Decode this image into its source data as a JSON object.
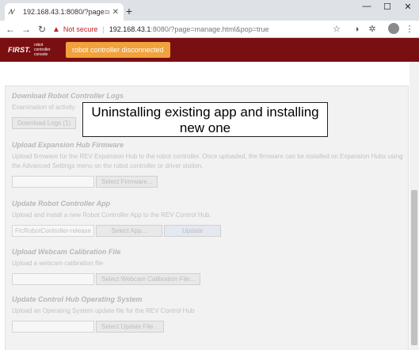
{
  "browser": {
    "tab_title": "192.168.43.1:8080/?page=manag",
    "tab_favicon": "⁄\\⁄",
    "new_tab": "+",
    "security_label": "Not secure",
    "url_host": "192.168.43.1",
    "url_rest": ":8080/?page=manage.html&pop=true"
  },
  "app": {
    "logo": "FIRST.",
    "logo_sub": "robot controller console",
    "status_button": "robot controller disconnected"
  },
  "sections": {
    "logs": {
      "title": "Download Robot Controller Logs",
      "desc": "Examination of activity",
      "button": "Download Logs (1)"
    },
    "firmware": {
      "title": "Upload Expansion Hub Firmware",
      "desc": "Upload firmware for the REV Expansion Hub to the robot controller. Once uploaded, the firmware can be installed on Expansion Hubs using the Advanced Settings menu on the robot controller or driver station.",
      "button": "Select Firmware..."
    },
    "update_app": {
      "title": "Update Robot Controller App",
      "desc": "Upload and install a new Robot Controller App to the REV Control Hub.",
      "file_value": "FtcRobotController-release",
      "select_button": "Select App...",
      "update_button": "Update"
    },
    "webcam": {
      "title": "Upload Webcam Calibration File",
      "desc": "Upload a webcam calibration file",
      "button": "Select Webcam Calibration File..."
    },
    "os": {
      "title": "Update Control Hub Operating System",
      "desc": "Upload an Operating System update file for the REV Control Hub",
      "button": "Select Update File..."
    }
  },
  "overlay": {
    "text": "Uninstalling existing app and installing new one"
  },
  "colors": {
    "header": "#7a0f12",
    "status_button": "#f0a23c",
    "warning": "#c5221f"
  }
}
